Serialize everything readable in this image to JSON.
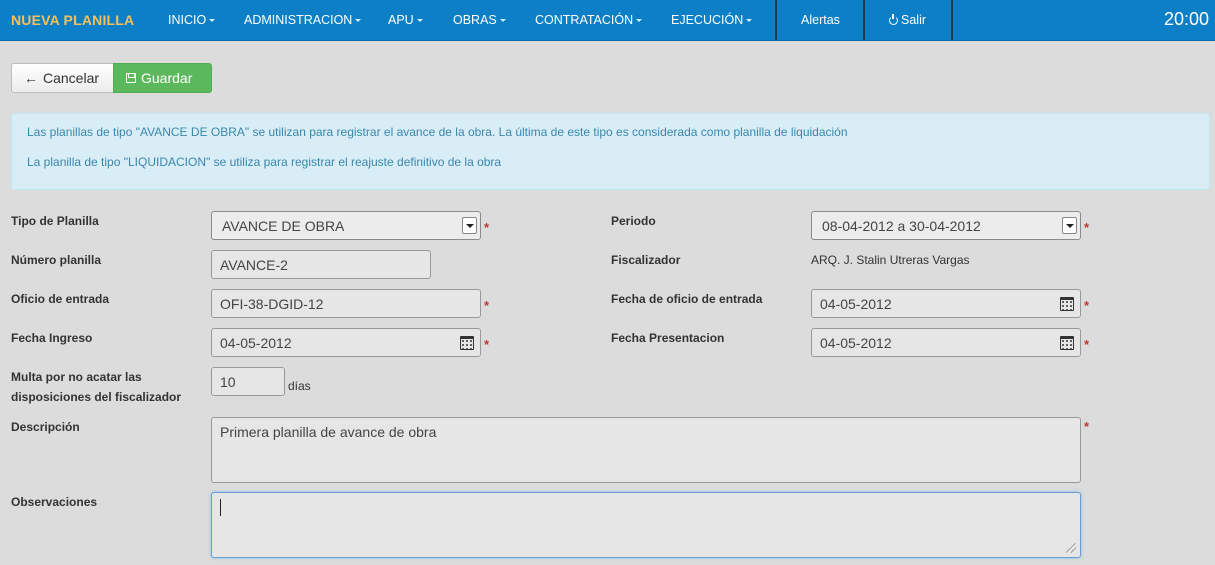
{
  "navbar": {
    "brand": "NUEVA PLANILLA",
    "menu": [
      "INICIO",
      "ADMINISTRACION",
      "APU",
      "OBRAS",
      "CONTRATACIÓN",
      "EJECUCIÓN"
    ],
    "alertas": "Alertas",
    "salir": "Salir",
    "clock": "20:00",
    "color": "#0d7fc6",
    "brand_color": "#f5c15a"
  },
  "toolbar": {
    "cancel_label": "Cancelar",
    "save_label": "Guardar",
    "cancel_icon": "arrow-left-icon",
    "save_icon": "floppy-disk-icon",
    "save_color": "#5cb85c"
  },
  "info": {
    "line1": "Las planillas de tipo \"AVANCE DE OBRA\" se utilizan para registrar el avance de la obra. La última de este tipo es considerada como planilla de liquidación",
    "line2": "La planilla de tipo \"LIQUIDACION\" se utiliza para registrar el reajuste definitivo de la obra"
  },
  "form": {
    "tipo_label": "Tipo de Planilla",
    "tipo_value": "AVANCE DE OBRA",
    "periodo_label": "Periodo",
    "periodo_value": "08-04-2012 a 30-04-2012",
    "numero_label": "Número planilla",
    "numero_value": "AVANCE-2",
    "fiscalizador_label": "Fiscalizador",
    "fiscalizador_value": "ARQ. J. Stalin Utreras Vargas",
    "oficio_label": "Oficio de entrada",
    "oficio_value": "OFI-38-DGID-12",
    "fecha_oficio_label": "Fecha de oficio de entrada",
    "fecha_oficio_value": "04-05-2012",
    "fecha_ingreso_label": "Fecha Ingreso",
    "fecha_ingreso_value": "04-05-2012",
    "fecha_presentacion_label": "Fecha Presentacion",
    "fecha_presentacion_value": "04-05-2012",
    "multa_label_1": "Multa por no acatar las",
    "multa_label_2": "disposiciones del fiscalizador",
    "multa_value": "10",
    "multa_unit": "días",
    "descripcion_label": "Descripción",
    "descripcion_value": "Primera planilla de avance de obra",
    "observaciones_label": "Observaciones",
    "observaciones_value": "",
    "required_mark": "*"
  }
}
